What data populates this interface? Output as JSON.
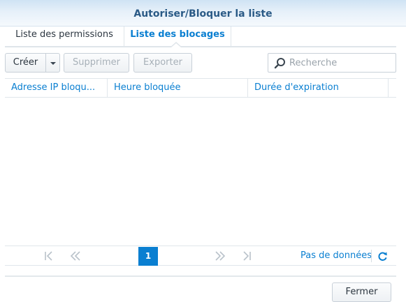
{
  "dialog": {
    "title": "Autoriser/Bloquer la liste"
  },
  "tabs": [
    {
      "label": "Liste des permissions",
      "active": false
    },
    {
      "label": "Liste des blocages",
      "active": true
    }
  ],
  "toolbar": {
    "create_label": "Créer",
    "delete_label": "Supprimer",
    "export_label": "Exporter",
    "search_placeholder": "Recherche"
  },
  "grid": {
    "columns": [
      "Adresse IP bloqu...",
      "Heure bloquée",
      "Durée d'expiration"
    ],
    "rows": []
  },
  "pager": {
    "current_page": "1",
    "status": "Pas de données"
  },
  "footer": {
    "close_label": "Fermer"
  },
  "colors": {
    "accent": "#0a7fd1",
    "title_text": "#2a5a86",
    "disabled_text": "#a7b0b8"
  },
  "icons": {
    "search": "search-icon",
    "first": "first-page-icon",
    "prev": "previous-page-icon",
    "next": "next-page-icon",
    "last": "last-page-icon",
    "refresh": "refresh-icon",
    "dropdown": "chevron-down-icon"
  }
}
